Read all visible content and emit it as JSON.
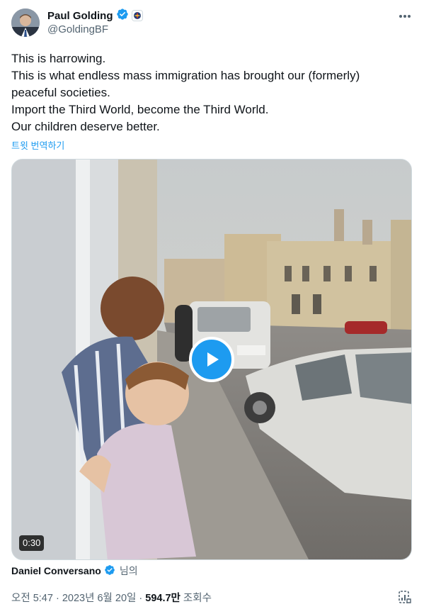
{
  "author": {
    "name": "Paul Golding",
    "handle": "@GoldingBF",
    "verified": true,
    "affiliation_badge": "party-logo-badge"
  },
  "tweet": {
    "lines": [
      "This is harrowing.",
      "This is what endless mass immigration has brought our (formerly)",
      "peaceful societies.",
      "Import the Third World, become the Third World.",
      "Our children deserve better."
    ],
    "translate_label": "트윗 번역하기"
  },
  "media": {
    "duration": "0:30",
    "play_icon": "play-icon"
  },
  "credit": {
    "creator": "Daniel Conversano",
    "suffix": "님의"
  },
  "meta": {
    "time": "오전 5:47",
    "sep1": " · ",
    "date": "2023년 6월 20일",
    "sep2": " · ",
    "views": "594.7만",
    "views_label": " 조회수"
  },
  "colors": {
    "accent": "#1d9bf0",
    "text": "#0f1419",
    "secondary": "#536471"
  }
}
